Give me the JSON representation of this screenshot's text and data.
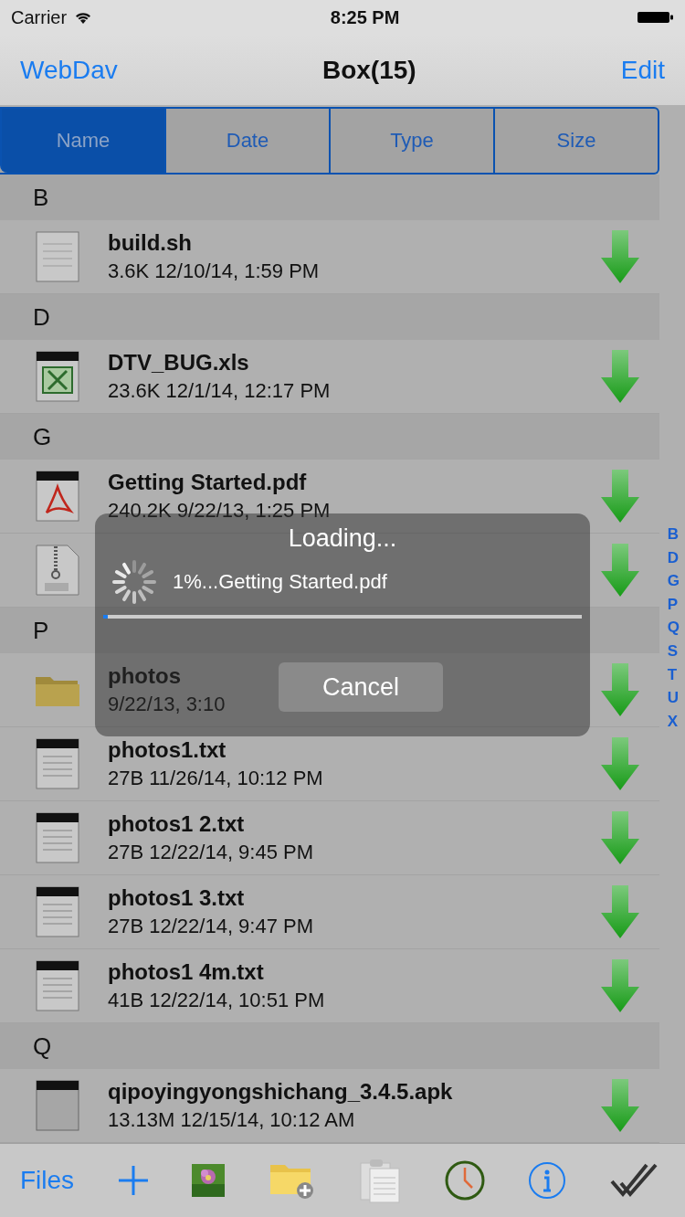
{
  "status_bar": {
    "carrier": "Carrier",
    "time": "8:25 PM"
  },
  "nav": {
    "back": "WebDav",
    "title": "Box(15)",
    "action": "Edit"
  },
  "tabs": [
    {
      "label": "Name",
      "selected": true
    },
    {
      "label": "Date",
      "selected": false
    },
    {
      "label": "Type",
      "selected": false
    },
    {
      "label": "Size",
      "selected": false
    }
  ],
  "sections": [
    {
      "letter": "B",
      "files": [
        {
          "name": "build.sh",
          "meta": "3.6K 12/10/14, 1:59 PM",
          "kind": "text"
        }
      ]
    },
    {
      "letter": "D",
      "files": [
        {
          "name": "DTV_BUG.xls",
          "meta": "23.6K 12/1/14, 12:17 PM",
          "kind": "xls"
        }
      ]
    },
    {
      "letter": "G",
      "files": [
        {
          "name": "Getting Started.pdf",
          "meta": "240.2K 9/22/13, 1:25 PM",
          "kind": "pdf"
        },
        {
          "kind": "zip"
        }
      ]
    },
    {
      "letter": "P",
      "files": [
        {
          "name": "photos",
          "meta": "9/22/13, 3:10",
          "kind": "folder"
        },
        {
          "name": "photos1.txt",
          "meta": "27B 11/26/14, 10:12 PM",
          "kind": "txt"
        },
        {
          "name": "photos1 2.txt",
          "meta": "27B 12/22/14, 9:45 PM",
          "kind": "txt"
        },
        {
          "name": "photos1 3.txt",
          "meta": "27B 12/22/14, 9:47 PM",
          "kind": "txt"
        },
        {
          "name": "photos1 4m.txt",
          "meta": "41B 12/22/14, 10:51 PM",
          "kind": "txt"
        }
      ]
    },
    {
      "letter": "Q",
      "files": [
        {
          "name": "qipoyingyongshichang_3.4.5.apk",
          "meta": "13.13M 12/15/14, 10:12 AM",
          "kind": "apk"
        }
      ]
    }
  ],
  "index": [
    "B",
    "D",
    "G",
    "P",
    "Q",
    "S",
    "T",
    "U",
    "X"
  ],
  "loading": {
    "title": "Loading...",
    "message": "1%...Getting Started.pdf",
    "level": 0.01,
    "cancel": "Cancel"
  },
  "toolbar": {
    "files": "Files"
  }
}
